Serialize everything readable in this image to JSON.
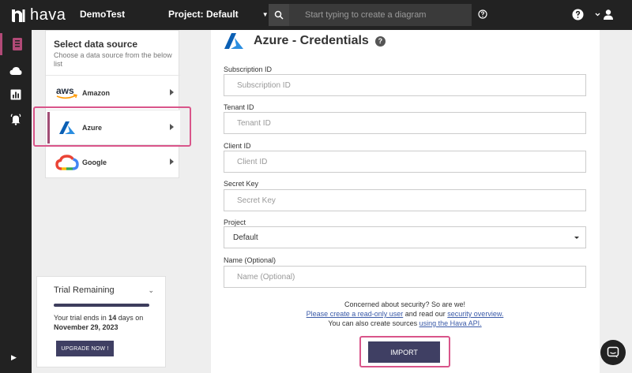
{
  "topbar": {
    "logo_text": "hava",
    "workspace": "DemoTest",
    "project": "Project: Default",
    "search_placeholder": "Start typing to create a diagram"
  },
  "data_source": {
    "title": "Select data source",
    "subtitle": "Choose a data source from the below list",
    "items": [
      {
        "label": "Amazon",
        "logo": "aws-logo"
      },
      {
        "label": "Azure",
        "logo": "azure-logo"
      },
      {
        "label": "Google",
        "logo": "google-cloud-logo"
      }
    ],
    "selected": "Azure",
    "aws_logo_text": "aws"
  },
  "trial": {
    "title": "Trial Remaining",
    "text_prefix": "Your trial ends in ",
    "days": "14",
    "text_mid": " days on",
    "date": "November 29, 2023",
    "button": "UPGRADE NOW !"
  },
  "form": {
    "title": "Azure - Credentials",
    "help_glyph": "?",
    "fields": [
      {
        "label": "Subscription ID",
        "placeholder": "Subscription ID"
      },
      {
        "label": "Tenant ID",
        "placeholder": "Tenant ID"
      },
      {
        "label": "Client ID",
        "placeholder": "Client ID"
      },
      {
        "label": "Secret Key",
        "placeholder": "Secret Key"
      }
    ],
    "project": {
      "label": "Project",
      "value": "Default"
    },
    "name": {
      "label": "Name (Optional)",
      "placeholder": "Name (Optional)"
    },
    "security": {
      "line1": "Concerned about security? So are we!",
      "link1": "Please create a read-only user",
      "mid": " and read our ",
      "link2": "security overview.",
      "line3_prefix": "You can also create sources ",
      "link3": "using the Hava API."
    },
    "import_button": "IMPORT"
  },
  "colors": {
    "topbar": "#222222",
    "accent": "#a14d75",
    "button": "#3f3f63",
    "highlight": "#d9558a"
  }
}
